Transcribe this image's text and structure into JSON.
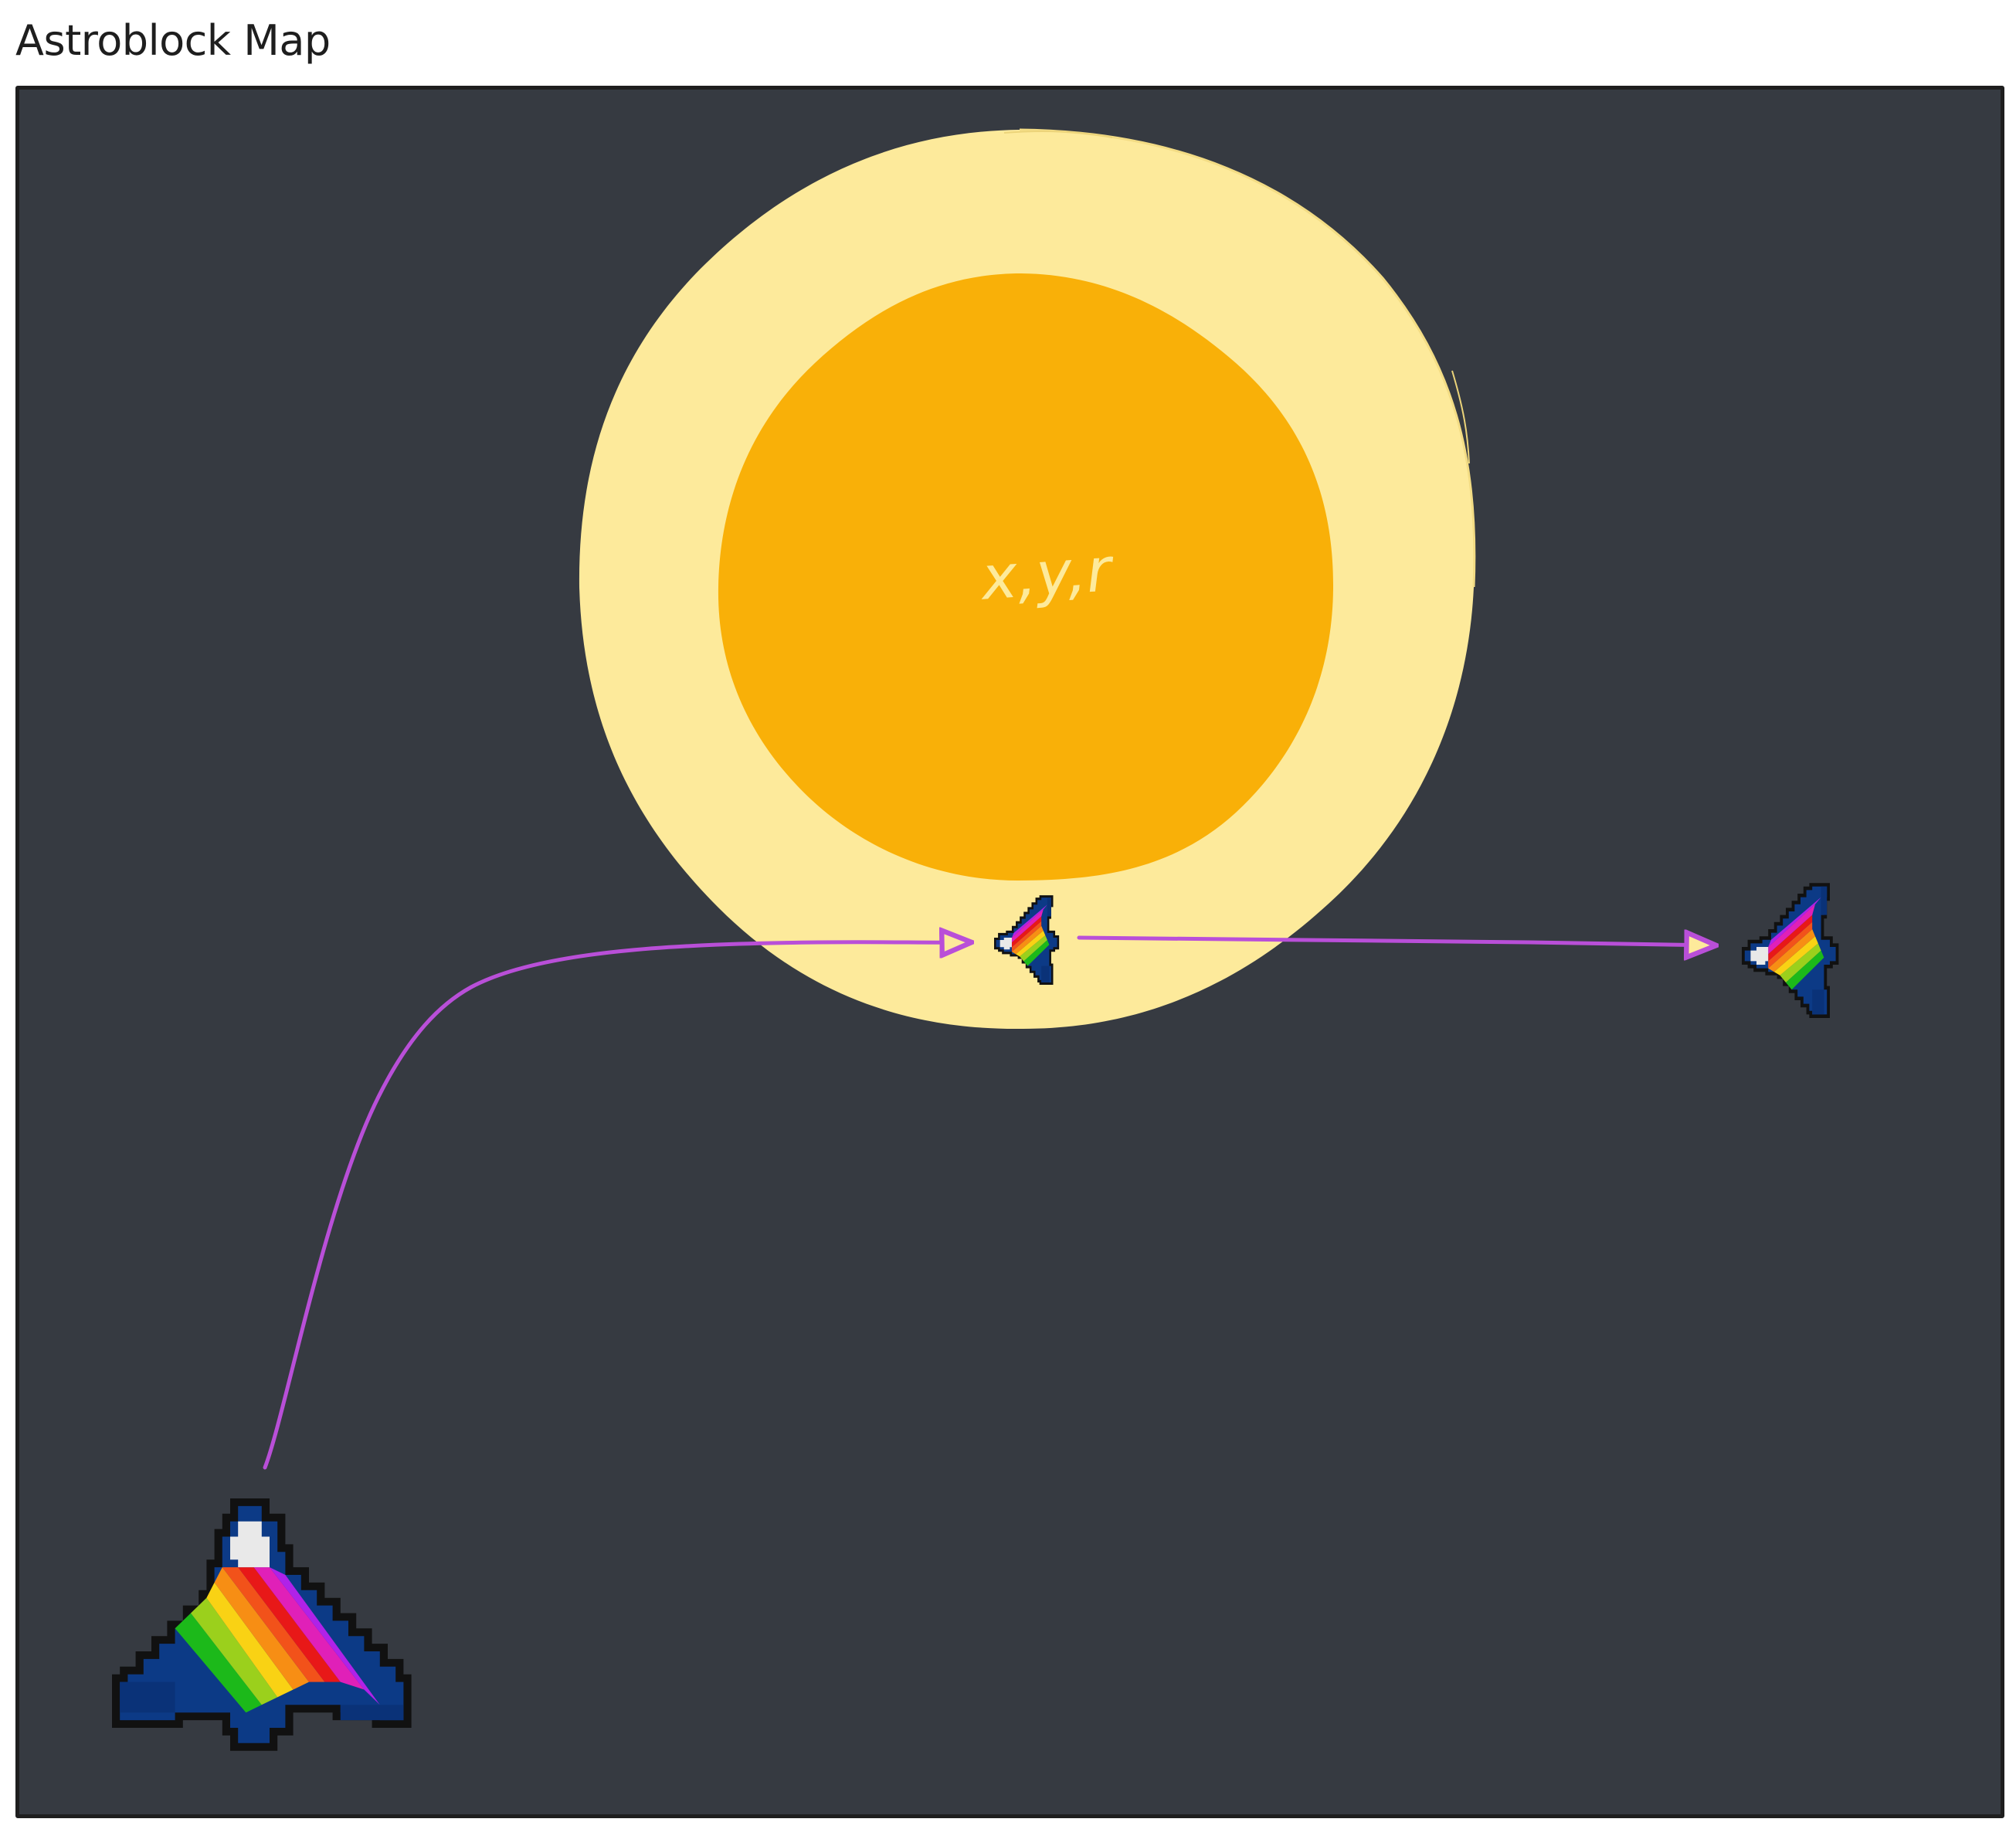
{
  "page": {
    "title": "Astroblock Map"
  },
  "planet": {
    "label": "x,y,r",
    "colors": {
      "atmosphere": "#fdea9b",
      "core": "#f9b008",
      "label": "#fdea9b"
    }
  },
  "path": {
    "color": "#b94fd8"
  },
  "ships": [
    {
      "name": "player-ship-large",
      "heading": "up"
    },
    {
      "name": "ship-in-orbit",
      "heading": "right"
    },
    {
      "name": "ship-exiting",
      "heading": "right"
    }
  ],
  "colors": {
    "background": "#363a41",
    "frame": "#1e1e1e",
    "ship_hull": "#0c3a86",
    "ship_outline": "#111111",
    "ship_cockpit": "#e9e9e9",
    "rainbow": [
      "#1cb91a",
      "#9bd01c",
      "#f9d214",
      "#f78e14",
      "#f2521a",
      "#e81818",
      "#e020b8",
      "#b022e8"
    ]
  }
}
